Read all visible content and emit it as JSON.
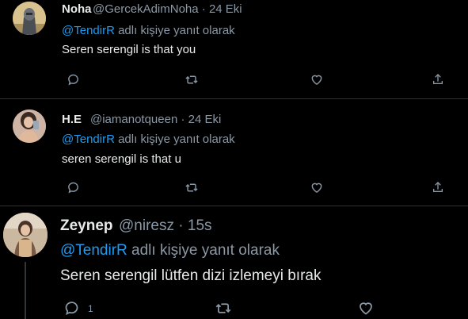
{
  "tweets": [
    {
      "display_name": "Noha",
      "handle": "@GercekAdimNoha",
      "separator": "·",
      "time": "24 Eki",
      "reply_mention": "@TendirR",
      "reply_suffix": "adlı kişiye yanıt olarak",
      "text": "Seren serengil is that you"
    },
    {
      "display_name": "H.E",
      "handle": "@iamanotqueen",
      "separator": "·",
      "time": "24 Eki",
      "reply_mention": "@TendirR",
      "reply_suffix": "adlı kişiye yanıt olarak",
      "text": "seren serengil is that u"
    },
    {
      "display_name": "Zeynep",
      "handle": "@niresz",
      "separator": "·",
      "time": "15s",
      "reply_mention": "@TendirR",
      "reply_suffix": "adlı kişiye yanıt olarak",
      "text": "Seren serengil lütfen dizi izlemeyi bırak",
      "reply_count": "1"
    }
  ],
  "colors": {
    "background": "#000000",
    "text": "#e7e9ea",
    "secondary": "#8b98a5",
    "link": "#1d9bf0",
    "divider": "#2f3336"
  },
  "icons": [
    "reply-icon",
    "retweet-icon",
    "like-icon",
    "share-icon"
  ]
}
